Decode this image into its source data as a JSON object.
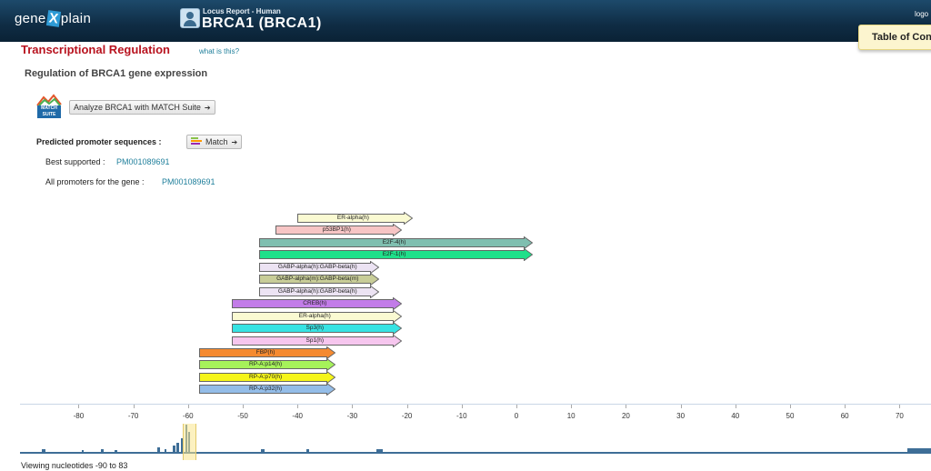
{
  "header": {
    "logo_left": "gene",
    "logo_x": "X",
    "logo_right": "plain",
    "subtitle": "Locus Report - Human",
    "title": "BRCA1 (BRCA1)",
    "logout": "logo",
    "toc_label": "Table of Con"
  },
  "section": {
    "title": "Transcriptional Regulation",
    "help_link": "what is this?",
    "heading": "Regulation of BRCA1 gene expression"
  },
  "match_suite": {
    "logo_line1": "MATCH",
    "logo_line2": "SUITE",
    "analyze_label": "Analyze BRCA1 with MATCH Suite",
    "arrow": "➔"
  },
  "promoters": {
    "predicted_label": "Predicted promoter sequences :",
    "match_label": "Match",
    "best_label": "Best supported :",
    "best_value": "PM001089691",
    "all_label": "All promoters for the gene :",
    "all_value": "PM001089691"
  },
  "tf_sites": [
    {
      "name": "ER-alpha(h)",
      "start": -40,
      "end": -19,
      "color": "#fafad2"
    },
    {
      "name": "p53BP1(h)",
      "start": -44,
      "end": -21,
      "color": "#f7c5c5"
    },
    {
      "name": "E2F-4(h)",
      "start": -47,
      "end": 3,
      "color": "#7fbfb0"
    },
    {
      "name": "E2F-1(h)",
      "start": -47,
      "end": 3,
      "color": "#1fe08a"
    },
    {
      "name": "GABP-alpha(h):GABP-beta(h)",
      "start": -47,
      "end": -25,
      "color": "#ece3f3"
    },
    {
      "name": "GABP-alpha(m):GABP-beta(m)",
      "start": -47,
      "end": -25,
      "color": "#c8cd98"
    },
    {
      "name": "GABP-alpha(h):GABP-beta(h)",
      "start": -47,
      "end": -25,
      "color": "#ece3f3"
    },
    {
      "name": "CREB(h)",
      "start": -52,
      "end": -21,
      "color": "#c27ce8"
    },
    {
      "name": "ER-alpha(h)",
      "start": -52,
      "end": -21,
      "color": "#fafad2"
    },
    {
      "name": "Sp3(h)",
      "start": -52,
      "end": -21,
      "color": "#36e3e3"
    },
    {
      "name": "Sp1(h)",
      "start": -52,
      "end": -21,
      "color": "#f6c6ee"
    },
    {
      "name": "FBP(h)",
      "start": -58,
      "end": -33,
      "color": "#f58a30"
    },
    {
      "name": "RP-A:p14(h)",
      "start": -58,
      "end": -33,
      "color": "#a6f25a"
    },
    {
      "name": "RP-A:p70(h)",
      "start": -58,
      "end": -33,
      "color": "#f5f51a"
    },
    {
      "name": "RP-A:p32(h)",
      "start": -58,
      "end": -33,
      "color": "#94bde8"
    }
  ],
  "axis": {
    "ticks": [
      -80,
      -70,
      -60,
      -50,
      -40,
      -30,
      -20,
      -10,
      0,
      10,
      20,
      30,
      40,
      50,
      60,
      70
    ]
  },
  "overview": {
    "viewing_text": "Viewing nucleotides -90 to 83"
  },
  "colors": {
    "header_bg": "#0f2c44",
    "section_title": "#b8121e",
    "link": "#1f7f9b",
    "histogram": "#3e6e97"
  }
}
